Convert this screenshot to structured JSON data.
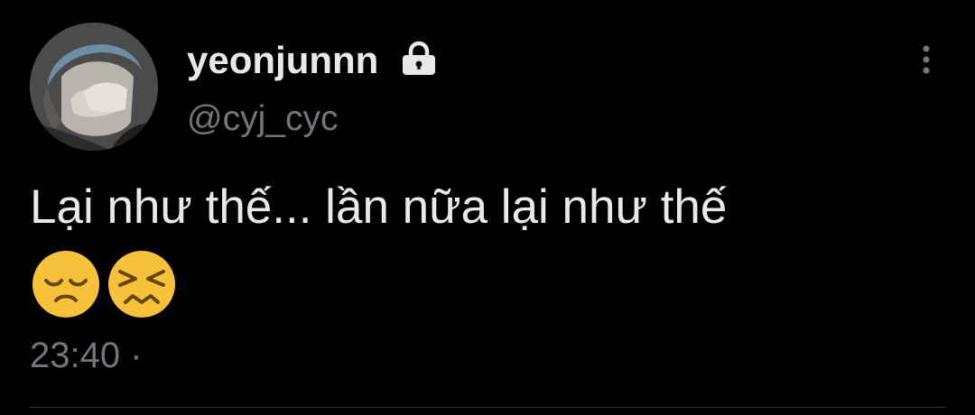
{
  "tweet": {
    "author": {
      "display_name": "yeonjunnn",
      "handle": "@cyj_cyc",
      "protected_icon": "lock-icon"
    },
    "more_icon": "more-vertical-icon",
    "text": "Lại như thế... lần nữa lại như thế",
    "emojis": [
      "disappointed-face-emoji",
      "persevering-face-emoji"
    ],
    "time": "23:40",
    "separator": "·"
  },
  "colors": {
    "background": "#000000",
    "primary_text": "#e7e9ea",
    "secondary_text": "#71767b",
    "emoji_yellow": "#f7c23a",
    "divider": "#2f3336"
  }
}
